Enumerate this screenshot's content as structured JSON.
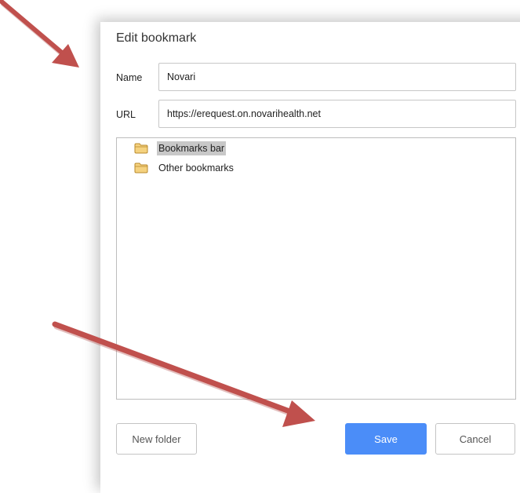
{
  "dialog": {
    "title": "Edit bookmark"
  },
  "form": {
    "name_label": "Name",
    "name_value": "Novari",
    "url_label": "URL",
    "url_value": "https://erequest.on.novarihealth.net"
  },
  "folders": [
    {
      "label": "Bookmarks bar",
      "icon": "folder-icon",
      "selected": true
    },
    {
      "label": "Other bookmarks",
      "icon": "folder-icon",
      "selected": false
    }
  ],
  "buttons": {
    "new_folder": "New folder",
    "save": "Save",
    "cancel": "Cancel"
  },
  "colors": {
    "primary": "#4b8df8",
    "selection": "#c8c8c8",
    "folder_fill": "#f5d27f",
    "folder_stroke": "#b98a2c",
    "annotation_arrow": "#c0504d"
  },
  "annotations": [
    {
      "type": "arrow",
      "points_to": "dialog-title"
    },
    {
      "type": "arrow",
      "points_to": "save-button"
    }
  ]
}
